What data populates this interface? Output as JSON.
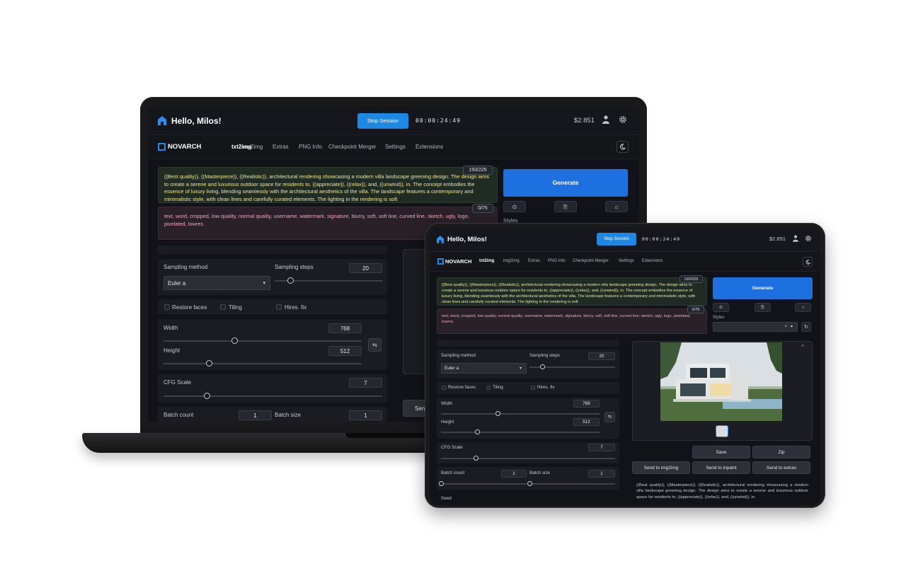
{
  "app": {
    "greeting": "Hello, Milos!",
    "stop_session": "Stop Session",
    "timer": "00:00:24:49",
    "credit": "$2.851",
    "brand": "NOVARCH",
    "nav": [
      "txt2img",
      "img2img",
      "Extras",
      "PNG Info",
      "Checkpoint Merger",
      "Settings",
      "Extensions"
    ]
  },
  "prompt": {
    "text": "((Best quality)), ((Masterpiece)), ((Realistic)), architectural rendering showcasing a modern villa landscape greening design. The design aims to create a serene and luxurious outdoor space for residents to, ((appreciate)), ((relax)), and, ((unwind)), in. The concept embodies the essence of luxury living, blending seamlessly with the architectural aesthetics of the villa. The landscape features a contemporary and minimalistic style, with clean lines and carefully curated elements. The lighting in the rendering is soft",
    "counter": "193/225"
  },
  "negative": {
    "text": "text, word, cropped, low quality, normal quality, username, watermark, signature, blurry, soft, soft line, curved line, sketch, ugly, logo, pixelated, lowres",
    "counter": "0/75"
  },
  "generate_label": "Generate",
  "styles_label": "Styles",
  "params": {
    "sampling_method_label": "Sampling method",
    "sampling_method": "Euler a",
    "sampling_steps_label": "Sampling steps",
    "sampling_steps": "20",
    "restore_faces": "Restore faces",
    "tiling": "Tiling",
    "hires_fix": "Hires. fix",
    "width_label": "Width",
    "width": "768",
    "height_label": "Height",
    "height": "512",
    "cfg_label": "CFG Scale",
    "cfg": "7",
    "batch_count_label": "Batch count",
    "batch_count": "1",
    "batch_size_label": "Batch size",
    "batch_size": "1",
    "seed_label": "Seed"
  },
  "slider_levels": {
    "sampling_steps": 0.15,
    "width": 0.36,
    "height": 0.23,
    "cfg": 0.2,
    "batch_count": 0.0,
    "batch_size": 0.0
  },
  "output": {
    "save": "Save",
    "zip": "Zip",
    "send_img2img": "Send to img2img",
    "send_inpaint": "Send to inpaint",
    "send_extras": "Send to extras",
    "laptop_send_partial": "Sen",
    "info": "((Best quality)), ((Masterpiece)), ((Realistic)), architectural rendering showcasing a modern villa landscape greening design. The design aims to create a serene and luxurious outdoor space for residents to, ((appreciate)), ((relax)), and, ((unwind)), in."
  },
  "icons": {
    "home": "home-icon",
    "user": "user-icon",
    "settings": "gear-icon",
    "theme": "moon-icon",
    "swap": "swap-icon",
    "refresh": "refresh-icon",
    "close": "close-icon"
  },
  "colors": {
    "accent": "#1e88e5",
    "generate": "#1e6fe0",
    "background": "#111318",
    "prompt_text": "#f1e59b",
    "negative_text": "#f0a6b8"
  }
}
